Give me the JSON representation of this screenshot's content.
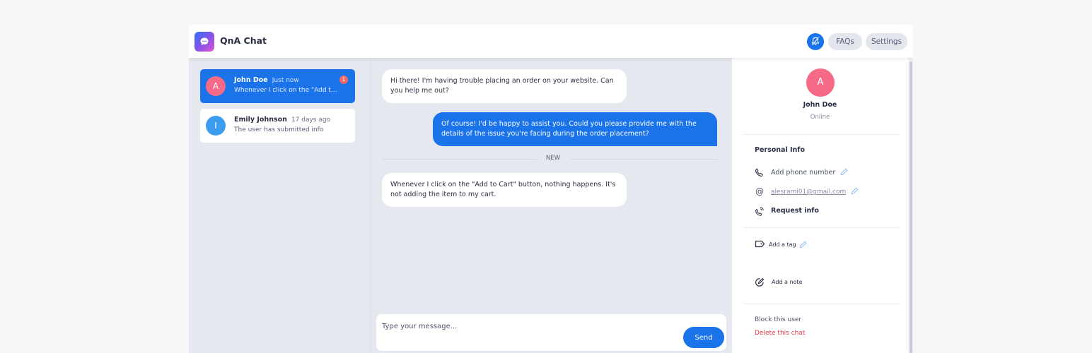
{
  "header": {
    "app_title": "QnA Chat",
    "faqs_label": "FAQs",
    "settings_label": "Settings",
    "accent_color": "#1a73e8"
  },
  "conversations": [
    {
      "initial": "A",
      "name": "John Doe",
      "time": "Just now",
      "preview": "Whenever I click on the \"Add t...",
      "unread": "1",
      "avatar_color": "#f56a86",
      "active": true
    },
    {
      "initial": "I",
      "name": "Emily Johnson",
      "time": "17 days ago",
      "preview": "The user has submitted info",
      "avatar_color": "#3b9cf0",
      "active": false
    }
  ],
  "messages": [
    {
      "direction": "in",
      "text": "Hi there! I'm having trouble placing an order on your website. Can you help me out?"
    },
    {
      "direction": "out",
      "text": "Of course! I'd be happy to assist you. Could you please provide me with the details of the issue you're facing during the order placement?"
    },
    {
      "direction": "in",
      "text": "Whenever I click on the \"Add to Cart\" button, nothing happens. It's not adding the item to my cart."
    }
  ],
  "divider_label": "NEW",
  "composer": {
    "placeholder": "Type your message...",
    "send_label": "Send"
  },
  "profile": {
    "initial": "A",
    "name": "John Doe",
    "status": "Online",
    "section_title": "Personal Info",
    "phone_label": "Add phone number",
    "email": "alesrami01@gmail.com",
    "request_info_label": "Request info",
    "add_tag_label": "Add a tag",
    "add_note_label": "Add a note",
    "block_label": "Block this user",
    "delete_label": "Delete this chat"
  }
}
